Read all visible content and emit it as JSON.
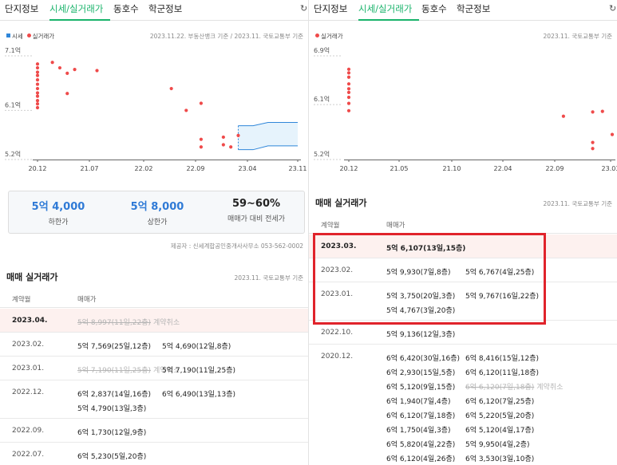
{
  "left": {
    "tabs": [
      {
        "label": "단지정보",
        "active": false
      },
      {
        "label": "시세/실거래가",
        "active": true
      },
      {
        "label": "동호수",
        "active": false
      },
      {
        "label": "학군정보",
        "active": false
      }
    ],
    "refresh_icon": "refresh-icon",
    "legend": {
      "market": "시세",
      "trade": "실거래가"
    },
    "chart_note": "2023.11.22. 부동산뱅크 기준 / 2023.11. 국토교통부 기준",
    "summary": [
      {
        "value": "5억 4,000",
        "label": "하한가"
      },
      {
        "value": "5억 8,000",
        "label": "상한가"
      },
      {
        "value": "59~60%",
        "label": "매매가 대비 전세가"
      }
    ],
    "provider": "제공자 : 신세계합공인중개사사무소 053-562-0002",
    "section_title": "매매 실거래가",
    "section_note": "2023.11. 국토교통부 기준",
    "table_headers": {
      "date": "계약월",
      "price": "매매가"
    },
    "rows": [
      {
        "date": "2023.04.",
        "highlight": true,
        "deals": [
          {
            "text": "5억 8,997(11일,22층)",
            "cancelled": true,
            "cancel_label": "계약취소"
          }
        ]
      },
      {
        "date": "2023.02.",
        "deals": [
          {
            "text": "5억 7,569(25일,12층)"
          },
          {
            "text": "5억 4,690(12일,8층)"
          }
        ]
      },
      {
        "date": "2023.01.",
        "deals": [
          {
            "text": "5억 7,190(11일,25층)",
            "cancelled": true,
            "cancel_label": "계약취소"
          },
          {
            "text": "5억 7,190(11일,25층)"
          }
        ]
      },
      {
        "date": "2022.12.",
        "deals": [
          {
            "text": "6억 2,837(14일,16층)"
          },
          {
            "text": "6억 6,490(13일,13층)"
          },
          {
            "text": "5억 4,790(13일,3층)"
          }
        ]
      },
      {
        "date": "2022.09.",
        "deals": [
          {
            "text": "6억 1,730(12일,9층)"
          }
        ]
      },
      {
        "date": "2022.07.",
        "deals": [
          {
            "text": "6억 5,230(5일,20층)"
          }
        ]
      }
    ]
  },
  "right": {
    "tabs": [
      {
        "label": "단지정보",
        "active": false
      },
      {
        "label": "시세/실거래가",
        "active": true
      },
      {
        "label": "동호수",
        "active": false
      },
      {
        "label": "학군정보",
        "active": false
      }
    ],
    "refresh_icon": "refresh-icon",
    "legend": {
      "trade": "실거래가"
    },
    "chart_note": "2023.11. 국토교통부 기준",
    "section_title": "매매 실거래가",
    "section_note": "2023.11. 국토교통부 기준",
    "table_headers": {
      "date": "계약월",
      "price": "매매가"
    },
    "rows": [
      {
        "date": "2023.03.",
        "highlight": true,
        "deals": [
          {
            "text": "5억 6,107(13일,15층)"
          }
        ]
      },
      {
        "date": "2023.02.",
        "deals": [
          {
            "text": "5억 9,930(7일,8층)"
          },
          {
            "text": "5억 6,767(4일,25층)"
          }
        ]
      },
      {
        "date": "2023.01.",
        "deals": [
          {
            "text": "5억 3,750(20일,3층)"
          },
          {
            "text": "5억 9,767(16일,22층)"
          },
          {
            "text": "5억 4,767(3일,20층)"
          }
        ]
      },
      {
        "date": "2022.10.",
        "deals": [
          {
            "text": "5억 9,136(12일,3층)"
          }
        ]
      },
      {
        "date": "2020.12.",
        "deals": [
          {
            "text": "6억 6,420(30일,16층)"
          },
          {
            "text": "6억 8,416(15일,12층)"
          },
          {
            "text": "6억 2,930(15일,5층)"
          },
          {
            "text": "6억 6,120(11일,18층)"
          },
          {
            "text": "6억 5,120(9일,15층)"
          },
          {
            "text": "6억 6,120(7일,18층)",
            "cancelled": true,
            "cancel_label": "계약취소"
          },
          {
            "text": "6억 1,940(7일,4층)"
          },
          {
            "text": "6억 6,120(7일,25층)"
          },
          {
            "text": "6억 6,120(7일,18층)"
          },
          {
            "text": "6억 5,220(5일,20층)"
          },
          {
            "text": "6억 1,750(4일,3층)"
          },
          {
            "text": "6억 5,120(4일,17층)"
          },
          {
            "text": "6억 5,820(4일,22층)"
          },
          {
            "text": "5억 9,950(4일,2층)"
          },
          {
            "text": "6억 6,120(4일,26층)"
          },
          {
            "text": "6억 3,530(3일,10층)"
          }
        ]
      }
    ]
  },
  "chart_data": [
    {
      "type": "scatter",
      "title": "",
      "xlabel": "",
      "ylabel": "",
      "x_ticks": [
        "20.12",
        "21.07",
        "22.02",
        "22.09",
        "23.04",
        "23.11"
      ],
      "y_ticks": [
        "7.1억",
        "6.1억",
        "5.2억"
      ],
      "ylim": [
        5.2,
        7.1
      ],
      "grid": false,
      "legend": "top-left",
      "colors": {
        "trade": "#ef4a4a",
        "market_band": "#2f86d9"
      },
      "series": [
        {
          "name": "실거래가",
          "points": [
            [
              "2020-12",
              6.95
            ],
            [
              "2020-12",
              6.88
            ],
            [
              "2020-12",
              6.8
            ],
            [
              "2020-12",
              6.74
            ],
            [
              "2020-12",
              6.66
            ],
            [
              "2020-12",
              6.58
            ],
            [
              "2020-12",
              6.5
            ],
            [
              "2020-12",
              6.42
            ],
            [
              "2020-12",
              6.36
            ],
            [
              "2020-12",
              6.28
            ],
            [
              "2020-12",
              6.22
            ],
            [
              "2020-12",
              6.15
            ],
            [
              "2021-02",
              6.98
            ],
            [
              "2021-03",
              6.88
            ],
            [
              "2021-04",
              6.78
            ],
            [
              "2021-04",
              6.41
            ],
            [
              "2021-05",
              6.85
            ],
            [
              "2021-08",
              6.83
            ],
            [
              "2022-06",
              6.5
            ],
            [
              "2022-08",
              6.1
            ],
            [
              "2022-10",
              6.23
            ],
            [
              "2022-10",
              5.57
            ],
            [
              "2022-10",
              5.43
            ],
            [
              "2023-01",
              5.61
            ],
            [
              "2023-01",
              5.47
            ],
            [
              "2023-02",
              5.43
            ],
            [
              "2023-03",
              5.64
            ]
          ]
        },
        {
          "name": "시세",
          "band": [
            [
              "2023-03",
              5.38,
              5.82
            ],
            [
              "2023-05",
              5.38,
              5.82
            ],
            [
              "2023-07",
              5.45,
              5.88
            ],
            [
              "2023-11",
              5.45,
              5.88
            ]
          ]
        }
      ]
    },
    {
      "type": "scatter",
      "title": "",
      "xlabel": "",
      "ylabel": "",
      "x_ticks": [
        "20.12",
        "21.05",
        "21.10",
        "22.04",
        "22.09",
        "23.03"
      ],
      "y_ticks": [
        "6.9억",
        "6.1억",
        "5.2억"
      ],
      "ylim": [
        5.2,
        6.9
      ],
      "grid": false,
      "legend": "top-left",
      "colors": {
        "trade": "#ef4a4a"
      },
      "series": [
        {
          "name": "실거래가",
          "points": [
            [
              "2020-12",
              6.68
            ],
            [
              "2020-12",
              6.62
            ],
            [
              "2020-12",
              6.55
            ],
            [
              "2020-12",
              6.44
            ],
            [
              "2020-12",
              6.36
            ],
            [
              "2020-12",
              6.3
            ],
            [
              "2020-12",
              6.22
            ],
            [
              "2020-12",
              6.12
            ],
            [
              "2020-12",
              6.0
            ],
            [
              "2022-10",
              5.91
            ],
            [
              "2023-01",
              5.98
            ],
            [
              "2023-01",
              5.48
            ],
            [
              "2023-01",
              5.38
            ],
            [
              "2023-02",
              5.99
            ],
            [
              "2023-03",
              5.61
            ]
          ]
        }
      ]
    }
  ]
}
